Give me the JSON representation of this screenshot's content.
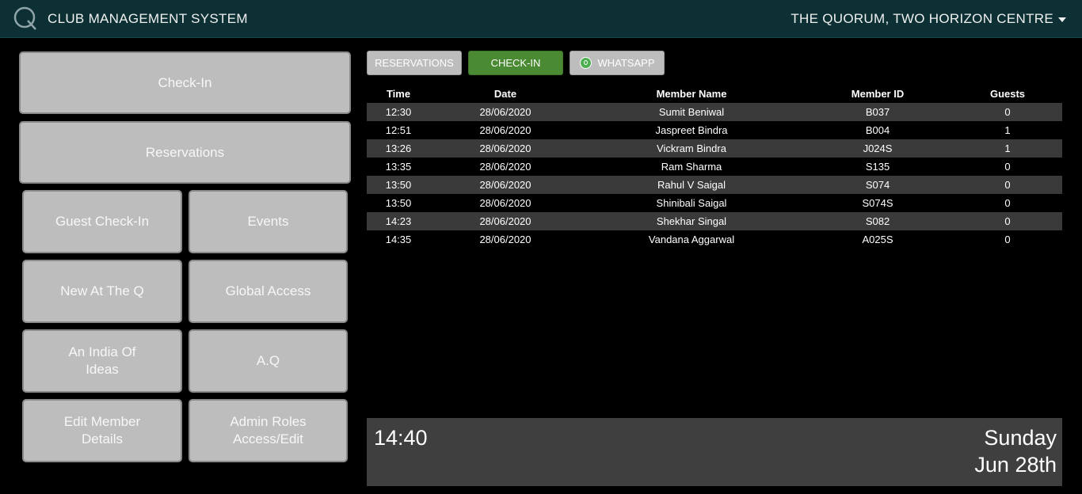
{
  "header": {
    "app_title": "CLUB MANAGEMENT SYSTEM",
    "location": "THE QUORUM, TWO HORIZON CENTRE"
  },
  "menu": {
    "check_in": "Check-In",
    "reservations": "Reservations",
    "guest_check_in": "Guest Check-In",
    "events": "Events",
    "new_at_the_q": "New At The Q",
    "global_access": "Global Access",
    "an_india_of_ideas": "An India Of\nIdeas",
    "aq": "A.Q",
    "edit_member_details": "Edit Member\nDetails",
    "admin_roles": "Admin Roles\nAccess/Edit"
  },
  "tabs": {
    "reservations": "RESERVATIONS",
    "check_in": "CHECK-IN",
    "whatsapp": "WHATSAPP"
  },
  "table": {
    "headers": [
      "Time",
      "Date",
      "Member Name",
      "Member ID",
      "Guests"
    ],
    "rows": [
      [
        "12:30",
        "28/06/2020",
        "Sumit Beniwal",
        "B037",
        "0"
      ],
      [
        "12:51",
        "28/06/2020",
        "Jaspreet Bindra",
        "B004",
        "1"
      ],
      [
        "13:26",
        "28/06/2020",
        "Vickram Bindra",
        "J024S",
        "1"
      ],
      [
        "13:35",
        "28/06/2020",
        "Ram Sharma",
        "S135",
        "0"
      ],
      [
        "13:50",
        "28/06/2020",
        "Rahul V Saigal",
        "S074",
        "0"
      ],
      [
        "13:50",
        "28/06/2020",
        "Shinibali Saigal",
        "S074S",
        "0"
      ],
      [
        "14:23",
        "28/06/2020",
        "Shekhar Singal",
        "S082",
        "0"
      ],
      [
        "14:35",
        "28/06/2020",
        "Vandana Aggarwal",
        "A025S",
        "0"
      ]
    ]
  },
  "clock": {
    "time": "14:40",
    "day": "Sunday",
    "date": "Jun 28th"
  },
  "colors": {
    "header_bg": "#0c3034",
    "tile_bg": "#bdbdbd",
    "active_tab": "#4a8a32",
    "row_stripe": "#3a3a3a",
    "clock_bg": "#3f3f3f"
  }
}
